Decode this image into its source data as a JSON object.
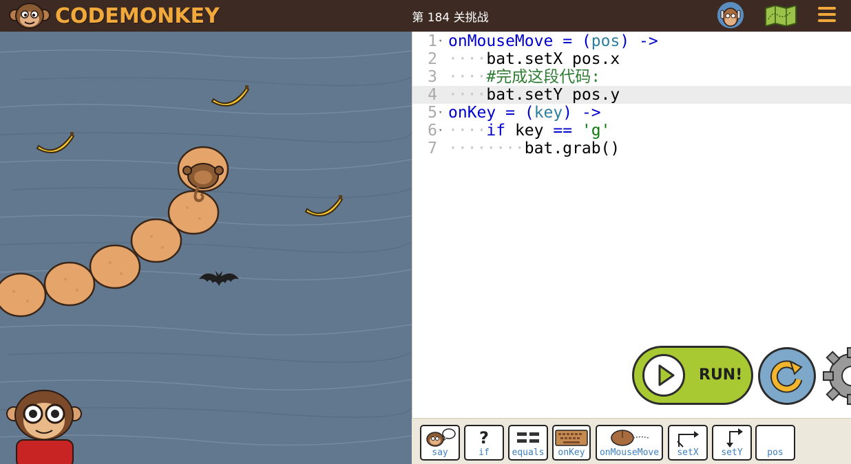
{
  "app": {
    "logo_text": "CODEMONKEY"
  },
  "header": {
    "title": "第 184 关挑战"
  },
  "editor": {
    "lines": [
      {
        "num": "1",
        "fold": "▾",
        "text": "onMouseMove = (pos) ->"
      },
      {
        "num": "2",
        "fold": "",
        "text": "    bat.setX pos.x"
      },
      {
        "num": "3",
        "fold": "",
        "text": "    #完成这段代码:"
      },
      {
        "num": "4",
        "fold": "",
        "text": "    bat.setY pos.y"
      },
      {
        "num": "5",
        "fold": "▾",
        "text": "onKey = (key) ->"
      },
      {
        "num": "6",
        "fold": "▾",
        "text": "    if key == 'g'"
      },
      {
        "num": "7",
        "fold": "",
        "text": "        bat.grab()"
      }
    ],
    "active_line": 4
  },
  "controls": {
    "run_label": "RUN!"
  },
  "palette": {
    "items": [
      {
        "label": "say",
        "icon": "monkey-speech-icon"
      },
      {
        "label": "if",
        "icon": "question-icon",
        "glyph": "?"
      },
      {
        "label": "equals",
        "icon": "equals-icon"
      },
      {
        "label": "onKey",
        "icon": "keyboard-icon"
      },
      {
        "label": "onMouseMove",
        "icon": "mouse-icon"
      },
      {
        "label": "setX",
        "icon": "set-x-arrow-icon"
      },
      {
        "label": "setY",
        "icon": "set-y-arrow-icon"
      },
      {
        "label": "pos",
        "icon": ""
      }
    ]
  },
  "colors": {
    "topbar": "#3d2b23",
    "accent_orange": "#f2a93b",
    "water": "#62788f",
    "run_green": "#a8c932",
    "reset_blue": "#7ea8c9"
  }
}
